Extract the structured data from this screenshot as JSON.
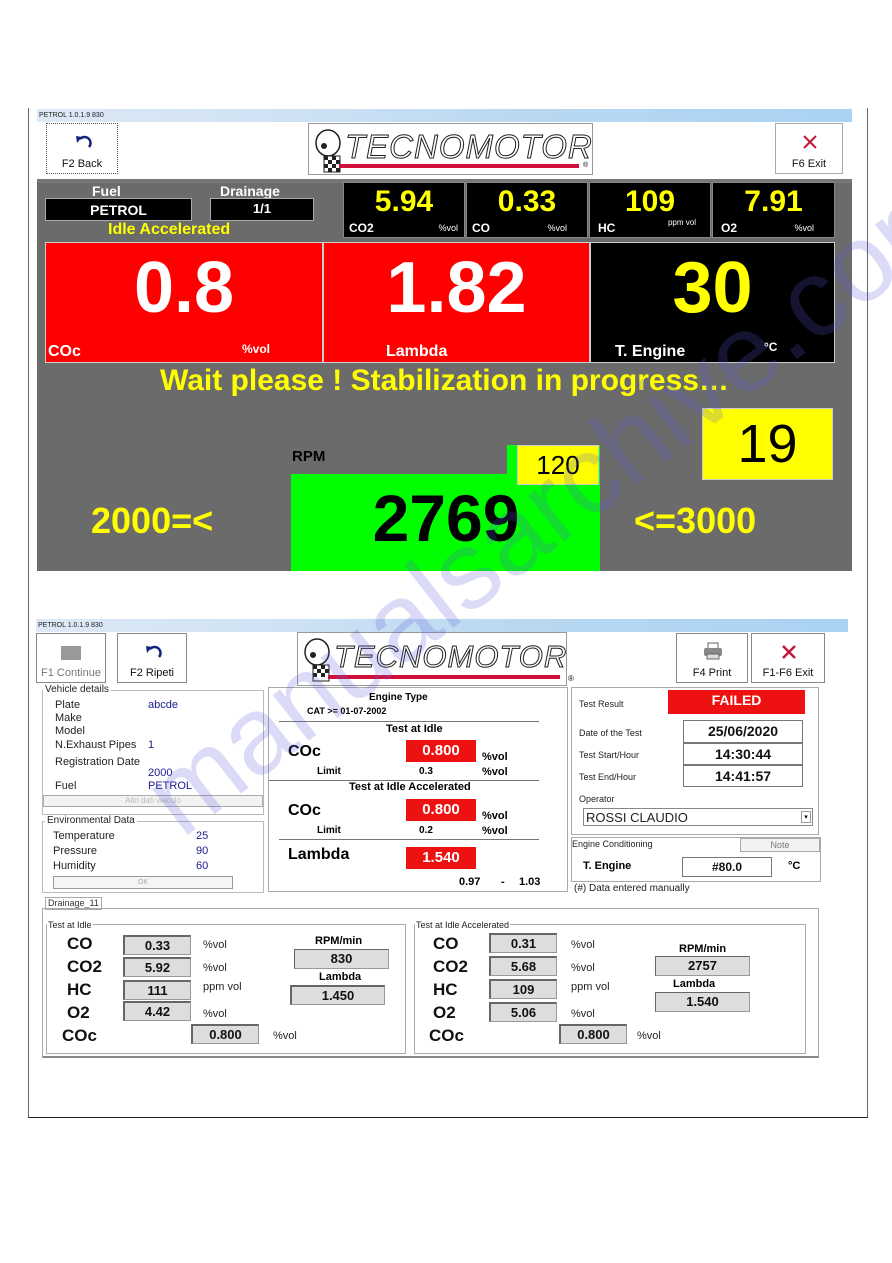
{
  "screen1": {
    "title": "PETROL 1.0.1.9  830",
    "buttons": {
      "back": "F2 Back",
      "exit": "F6 Exit"
    },
    "logo": "TECNOMOTOR",
    "fuel_label": "Fuel",
    "fuel_value": "PETROL",
    "drainage_label": "Drainage",
    "drainage_value": "1/1",
    "phase": "Idle Accelerated",
    "gases": [
      {
        "value": "5.94",
        "name": "CO2",
        "unit": "%vol"
      },
      {
        "value": "0.33",
        "name": "CO",
        "unit": "%vol"
      },
      {
        "value": "109",
        "name": "HC",
        "unit": "ppm vol"
      },
      {
        "value": "7.91",
        "name": "O2",
        "unit": "%vol"
      }
    ],
    "coc": {
      "value": "0.8",
      "label": "COc",
      "unit": "%vol"
    },
    "lambda": {
      "value": "1.82",
      "label": "Lambda"
    },
    "t_engine": {
      "value": "30",
      "label": "T. Engine",
      "unit": "°C"
    },
    "message": "Wait please ! Stabilization in progress…",
    "countdown": "19",
    "rpm_label": "RPM",
    "rpm_value": "2769",
    "rpm_sub": "120",
    "rpm_min": "2000=<",
    "rpm_max": "<=3000",
    "colors": {
      "panel": "#6b6b6b",
      "red": "#ff0000",
      "yellow": "#ffff00",
      "green": "#00ff00"
    }
  },
  "screen2": {
    "title": "PETROL 1.0.1.9  830",
    "buttons": {
      "continue": "F1 Continue",
      "repeat": "F2 Ripeti",
      "print": "F4 Print",
      "exit": "F1-F6 Exit"
    },
    "logo": "TECNOMOTOR",
    "vehicle": {
      "legend": "Vehicle details",
      "rows": [
        {
          "label": "Plate",
          "value": "abcde"
        },
        {
          "label": "Make",
          "value": ""
        },
        {
          "label": "Model",
          "value": ""
        },
        {
          "label": "N.Exhaust Pipes",
          "value": "1"
        },
        {
          "label": "Registration Date",
          "value": "2000"
        },
        {
          "label": "Fuel",
          "value": "PETROL"
        }
      ],
      "more_button": "Altri dati veicolo"
    },
    "environment": {
      "legend": "Environmental Data",
      "rows": [
        {
          "label": "Temperature",
          "value": "25"
        },
        {
          "label": "Pressure",
          "value": "90"
        },
        {
          "label": "Humidity",
          "value": "60"
        }
      ],
      "button": "OK"
    },
    "limits": {
      "engine_type_label": "Engine Type",
      "engine_type": "CAT >= 01-07-2002",
      "idle_title": "Test at Idle",
      "idle_coc": "0.800",
      "idle_limit": "0.3",
      "accel_title": "Test at Idle Accelerated",
      "accel_coc": "0.800",
      "accel_limit": "0.2",
      "coc_label": "COc",
      "limit_label": "Limit",
      "unit": "%vol",
      "lambda_label": "Lambda",
      "lambda_value": "1.540",
      "lambda_min": "0.97",
      "lambda_sep": "-",
      "lambda_max": "1.03"
    },
    "result": {
      "label": "Test Result",
      "value": "FAILED",
      "date_label": "Date of the Test",
      "date": "25/06/2020",
      "start_label": "Test Start/Hour",
      "start": "14:30:44",
      "end_label": "Test End/Hour",
      "end": "14:41:57",
      "operator_label": "Operator",
      "operator": "ROSSI CLAUDIO"
    },
    "conditioning": {
      "legend": "Engine Conditioning",
      "note_button": "Note",
      "t_engine_label": "T. Engine",
      "t_engine_value": "#80.0",
      "unit": "°C",
      "footnote": "(#) Data entered manually"
    },
    "drainage_tab": "Drainage_11",
    "tests": [
      {
        "title": "Test at Idle",
        "gases": [
          {
            "name": "CO",
            "value": "0.33",
            "unit": "%vol"
          },
          {
            "name": "CO2",
            "value": "5.92",
            "unit": "%vol"
          },
          {
            "name": "HC",
            "value": "111",
            "unit": "ppm vol"
          },
          {
            "name": "O2",
            "value": "4.42",
            "unit": "%vol"
          }
        ],
        "coc": {
          "name": "COc",
          "value": "0.800",
          "unit": "%vol"
        },
        "rpm_label": "RPM/min",
        "rpm": "830",
        "lambda_label": "Lambda",
        "lambda": "1.450"
      },
      {
        "title": "Test at Idle Accelerated",
        "gases": [
          {
            "name": "CO",
            "value": "0.31",
            "unit": "%vol"
          },
          {
            "name": "CO2",
            "value": "5.68",
            "unit": "%vol"
          },
          {
            "name": "HC",
            "value": "109",
            "unit": "ppm vol"
          },
          {
            "name": "O2",
            "value": "5.06",
            "unit": "%vol"
          }
        ],
        "coc": {
          "name": "COc",
          "value": "0.800",
          "unit": "%vol"
        },
        "rpm_label": "RPM/min",
        "rpm": "2757",
        "lambda_label": "Lambda",
        "lambda": "1.540"
      }
    ]
  },
  "watermark": "manualsarchive.com"
}
